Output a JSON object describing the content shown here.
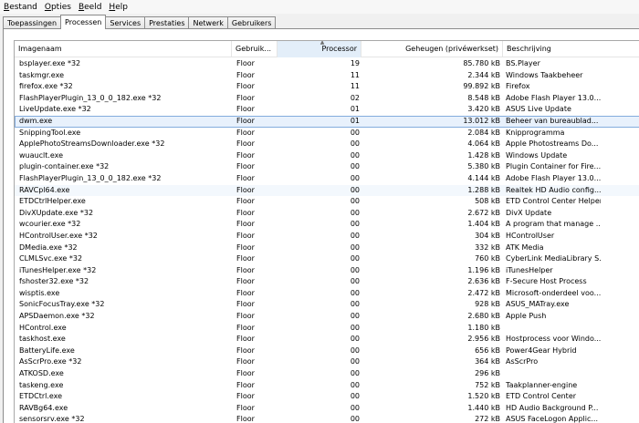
{
  "menubar": {
    "items": [
      {
        "label": "Bestand",
        "u": "B",
        "rest": "estand"
      },
      {
        "label": "Opties",
        "u": "O",
        "rest": "pties"
      },
      {
        "label": "Beeld",
        "u": "B",
        "rest": "eeld"
      },
      {
        "label": "Help",
        "u": "H",
        "rest": "elp"
      }
    ]
  },
  "tabs": [
    {
      "label": "Toepassingen",
      "active": false
    },
    {
      "label": "Processen",
      "active": true
    },
    {
      "label": "Services",
      "active": false
    },
    {
      "label": "Prestaties",
      "active": false
    },
    {
      "label": "Netwerk",
      "active": false
    },
    {
      "label": "Gebruikers",
      "active": false
    }
  ],
  "table": {
    "columns": [
      "Imagenaam",
      "Gebruik...",
      "Processor",
      "Geheugen (privéwerkset)",
      "Beschrijving"
    ],
    "sorted_column": 2,
    "sort_glyph": "▲",
    "selected_row": 5,
    "hover_row": 11,
    "rows": [
      [
        "bsplayer.exe *32",
        "Floor",
        "19",
        "85.780 kB",
        "BS.Player"
      ],
      [
        "taskmgr.exe",
        "Floor",
        "11",
        "2.344 kB",
        "Windows Taakbeheer"
      ],
      [
        "firefox.exe *32",
        "Floor",
        "11",
        "99.892 kB",
        "Firefox"
      ],
      [
        "FlashPlayerPlugin_13_0_0_182.exe *32",
        "Floor",
        "02",
        "8.548 kB",
        "Adobe Flash Player 13.0..."
      ],
      [
        "LiveUpdate.exe *32",
        "Floor",
        "01",
        "3.420 kB",
        "ASUS Live Update"
      ],
      [
        "dwm.exe",
        "Floor",
        "01",
        "13.012 kB",
        "Beheer van bureaublad..."
      ],
      [
        "SnippingTool.exe",
        "Floor",
        "00",
        "2.084 kB",
        "Knipprogramma"
      ],
      [
        "ApplePhotoStreamsDownloader.exe *32",
        "Floor",
        "00",
        "4.064 kB",
        "Apple Photostreams Do..."
      ],
      [
        "wuauclt.exe",
        "Floor",
        "00",
        "1.428 kB",
        "Windows Update"
      ],
      [
        "plugin-container.exe *32",
        "Floor",
        "00",
        "5.380 kB",
        "Plugin Container for Fire..."
      ],
      [
        "FlashPlayerPlugin_13_0_0_182.exe *32",
        "Floor",
        "00",
        "4.144 kB",
        "Adobe Flash Player 13.0..."
      ],
      [
        "RAVCpl64.exe",
        "Floor",
        "00",
        "1.288 kB",
        "Realtek HD Audio config..."
      ],
      [
        "ETDCtrlHelper.exe",
        "Floor",
        "00",
        "508 kB",
        "ETD Control Center Helper"
      ],
      [
        "DivXUpdate.exe *32",
        "Floor",
        "00",
        "2.672 kB",
        "DivX Update"
      ],
      [
        "wcourier.exe *32",
        "Floor",
        "00",
        "1.404 kB",
        "A program that manage ..."
      ],
      [
        "HControlUser.exe *32",
        "Floor",
        "00",
        "304 kB",
        "HControlUser"
      ],
      [
        "DMedia.exe *32",
        "Floor",
        "00",
        "332 kB",
        "ATK Media"
      ],
      [
        "CLMLSvc.exe *32",
        "Floor",
        "00",
        "760 kB",
        "CyberLink MediaLibrary S..."
      ],
      [
        "iTunesHelper.exe *32",
        "Floor",
        "00",
        "1.196 kB",
        "iTunesHelper"
      ],
      [
        "fshoster32.exe *32",
        "Floor",
        "00",
        "2.636 kB",
        "F-Secure Host Process"
      ],
      [
        "wisptis.exe",
        "Floor",
        "00",
        "2.472 kB",
        "Microsoft-onderdeel voo..."
      ],
      [
        "SonicFocusTray.exe *32",
        "Floor",
        "00",
        "928 kB",
        "ASUS_MATray.exe"
      ],
      [
        "APSDaemon.exe *32",
        "Floor",
        "00",
        "2.680 kB",
        "Apple Push"
      ],
      [
        "HControl.exe",
        "Floor",
        "00",
        "1.180 kB",
        ""
      ],
      [
        "taskhost.exe",
        "Floor",
        "00",
        "2.956 kB",
        "Hostprocess voor Windo..."
      ],
      [
        "BatteryLife.exe",
        "Floor",
        "00",
        "656 kB",
        "Power4Gear Hybrid"
      ],
      [
        "AsScrPro.exe *32",
        "Floor",
        "00",
        "364 kB",
        "AsScrPro"
      ],
      [
        "ATKOSD.exe",
        "Floor",
        "00",
        "296 kB",
        ""
      ],
      [
        "taskeng.exe",
        "Floor",
        "00",
        "752 kB",
        "Taakplanner-engine"
      ],
      [
        "ETDCtrl.exe",
        "Floor",
        "00",
        "1.520 kB",
        "ETD Control Center"
      ],
      [
        "RAVBg64.exe",
        "Floor",
        "00",
        "1.440 kB",
        "HD Audio Background P..."
      ],
      [
        "sensorsrv.exe *32",
        "Floor",
        "00",
        "272 kB",
        "ASUS FaceLogon Applic..."
      ]
    ]
  }
}
